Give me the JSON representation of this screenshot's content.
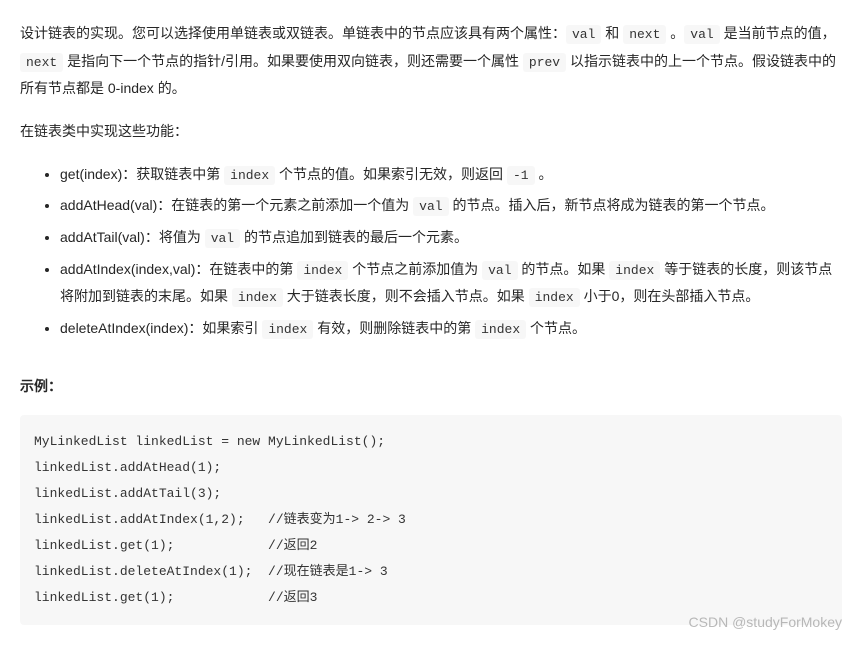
{
  "intro": {
    "p1_a": "设计链表的实现。您可以选择使用单链表或双链表。单链表中的节点应该具有两个属性：",
    "val": "val",
    "and": " 和 ",
    "next": "next",
    "p1_b": " 。",
    "p1_c": " 是当前节点的值，",
    "p1_d": " 是指向下一个节点的指针/引用。如果要使用双向链表，则还需要一个属性 ",
    "prev": "prev",
    "p1_e": " 以指示链表中的上一个节点。假设链表中的所有节点都是 0-index 的。"
  },
  "subhead": "在链表类中实现这些功能：",
  "bullets": {
    "get_a": "get(index)：获取链表中第 ",
    "get_b": " 个节点的值。如果索引无效，则返回 ",
    "get_c": " 。",
    "index": "index",
    "neg1": "-1",
    "head_a": "addAtHead(val)：在链表的第一个元素之前添加一个值为 ",
    "head_b": " 的节点。插入后，新节点将成为链表的第一个节点。",
    "val": "val",
    "tail_a": "addAtTail(val)：将值为 ",
    "tail_b": " 的节点追加到链表的最后一个元素。",
    "addidx_a": "addAtIndex(index,val)：在链表中的第 ",
    "addidx_b": " 个节点之前添加值为 ",
    "addidx_c": " 的节点。如果 ",
    "addidx_d": " 等于链表的长度，则该节点将附加到链表的末尾。如果 ",
    "addidx_e": " 大于链表长度，则不会插入节点。如果 ",
    "addidx_f": " 小于0，则在头部插入节点。",
    "del_a": "deleteAtIndex(index)：如果索引 ",
    "del_b": " 有效，则删除链表中的第 ",
    "del_c": " 个节点。"
  },
  "example_label": "示例：",
  "code": "MyLinkedList linkedList = new MyLinkedList();\nlinkedList.addAtHead(1);\nlinkedList.addAtTail(3);\nlinkedList.addAtIndex(1,2);   //链表变为1-> 2-> 3\nlinkedList.get(1);            //返回2\nlinkedList.deleteAtIndex(1);  //现在链表是1-> 3\nlinkedList.get(1);            //返回3",
  "watermark": "CSDN @studyForMokey"
}
